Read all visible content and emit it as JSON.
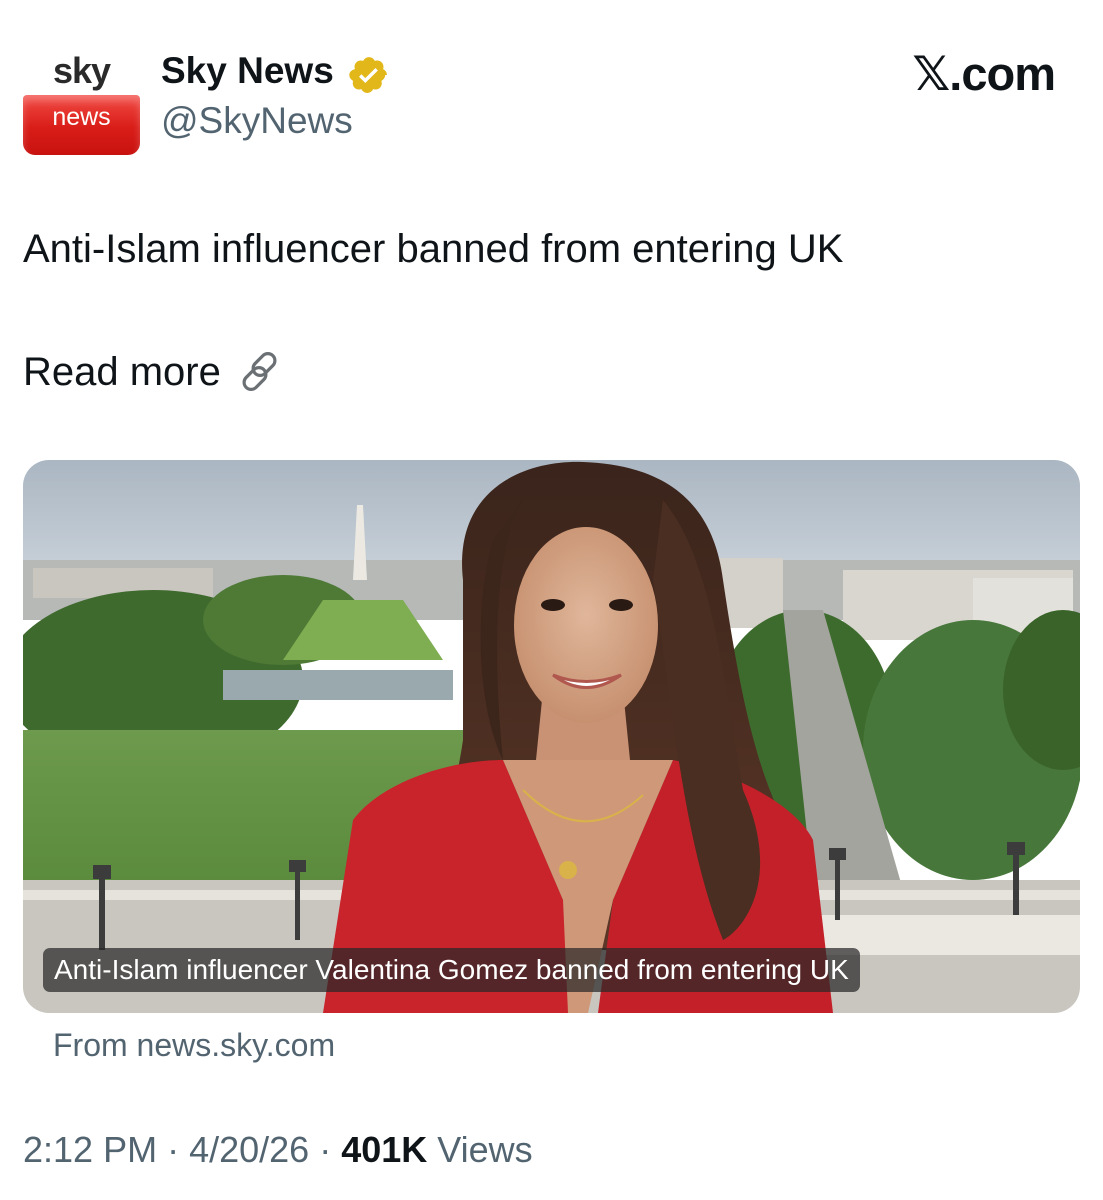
{
  "author": {
    "logo_top": "sky",
    "logo_bottom": "news",
    "name": "Sky News",
    "handle": "@SkyNews",
    "verified_badge": "gold-verified-icon"
  },
  "brand": "𝕏.com",
  "tweet": {
    "text": "Anti-Islam influencer banned from entering UK",
    "read_more": "Read more",
    "link_icon": "link-icon"
  },
  "card": {
    "caption": "Anti-Islam influencer Valentina Gomez banned from entering UK",
    "source": "From news.sky.com"
  },
  "meta": {
    "time": "2:12 PM",
    "sep1": " · ",
    "date": "4/20/26",
    "sep2": " · ",
    "views_count": "401K",
    "views_label": " Views"
  },
  "colors": {
    "text_primary": "#0f1419",
    "text_secondary": "#536471",
    "sky_red": "#d91d18",
    "verified_gold": "#e2b719"
  }
}
